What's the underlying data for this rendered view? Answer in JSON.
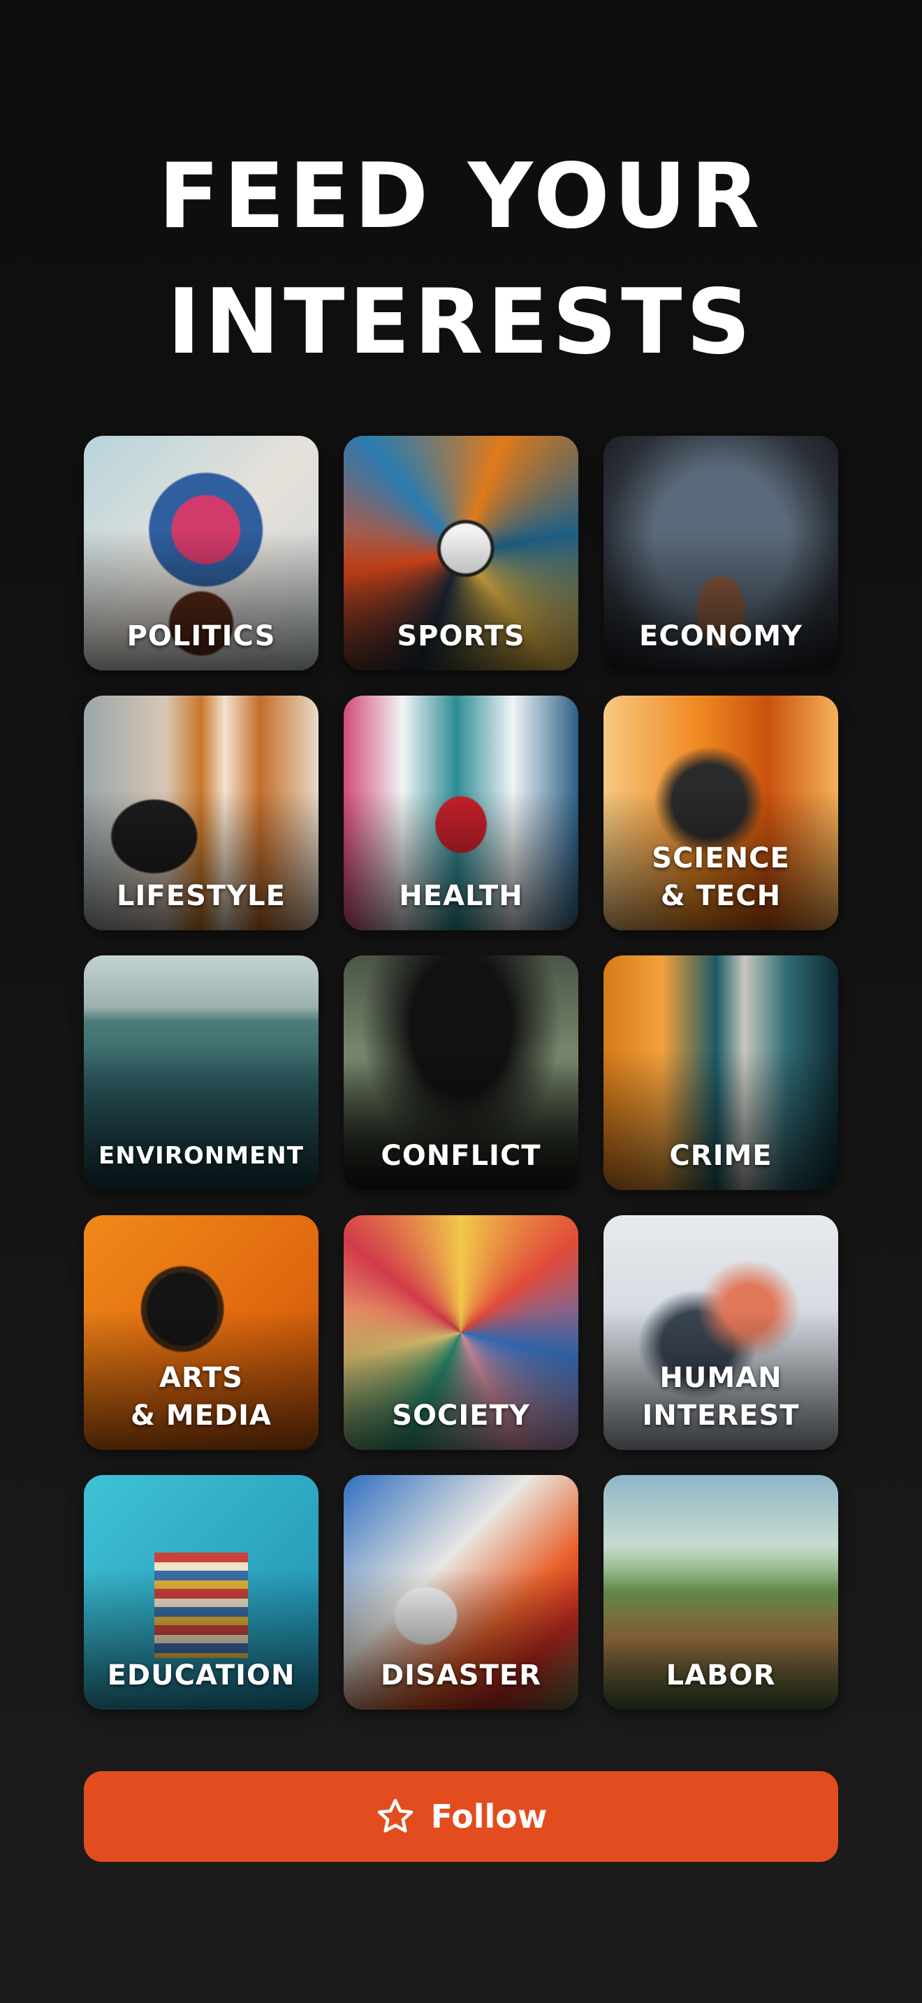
{
  "header": {
    "title_line1": "FEED YOUR",
    "title_line2": "INTERESTS"
  },
  "categories": [
    {
      "label": "POLITICS",
      "icon": "globe-image"
    },
    {
      "label": "SPORTS",
      "icon": "soccer-ball-image"
    },
    {
      "label": "ECONOMY",
      "icon": "bull-image"
    },
    {
      "label": "LIFESTYLE",
      "icon": "relaxing-man-image"
    },
    {
      "label": "HEALTH",
      "icon": "doctor-heart-image"
    },
    {
      "label": "SCIENCE\n& TECH",
      "icon": "vr-headset-image"
    },
    {
      "label": "ENVIRONMENT",
      "icon": "coral-reef-image"
    },
    {
      "label": "CONFLICT",
      "icon": "soldiers-smoke-image"
    },
    {
      "label": "CRIME",
      "icon": "lady-justice-image"
    },
    {
      "label": "ARTS\n& MEDIA",
      "icon": "television-image"
    },
    {
      "label": "SOCIETY",
      "icon": "crowd-painting-image"
    },
    {
      "label": "HUMAN\nINTEREST",
      "icon": "silhouettes-image"
    },
    {
      "label": "EDUCATION",
      "icon": "book-stack-image"
    },
    {
      "label": "DISASTER",
      "icon": "ambulance-image"
    },
    {
      "label": "LABOR",
      "icon": "industrial-town-image"
    }
  ],
  "follow_button": {
    "label": "Follow",
    "icon": "star-outline-icon",
    "color": "#e24c1e"
  }
}
